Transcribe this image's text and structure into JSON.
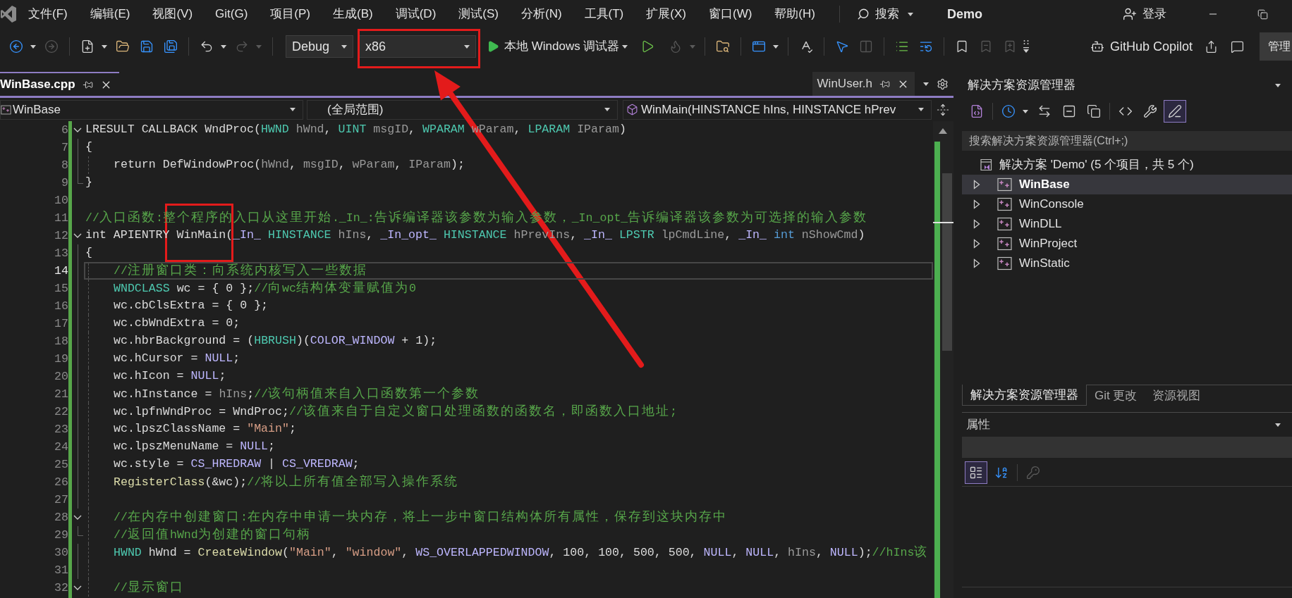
{
  "menu_bar": {
    "items": [
      "文件(F)",
      "编辑(E)",
      "视图(V)",
      "Git(G)",
      "项目(P)",
      "生成(B)",
      "调试(D)",
      "测试(S)",
      "分析(N)",
      "工具(T)",
      "扩展(X)",
      "窗口(W)",
      "帮助(H)"
    ],
    "search": "搜索",
    "solution": "Demo",
    "sign_in": "登录"
  },
  "toolbar": {
    "groups": [
      [
        {
          "kind": "back",
          "disabled": false
        },
        {
          "kind": "forward",
          "disabled": true
        }
      ],
      [
        {
          "kind": "new-item",
          "disabled": false
        },
        {
          "kind": "open",
          "disabled": false
        },
        {
          "kind": "save",
          "disabled": false
        },
        {
          "kind": "save-all",
          "disabled": false
        }
      ],
      [
        {
          "kind": "undo",
          "disabled": false
        },
        {
          "kind": "redo",
          "disabled": true
        }
      ],
      [
        {
          "kind": "configuration",
          "value": "Debug",
          "disabled": false
        },
        {
          "kind": "platform",
          "value": "x86",
          "disabled": false
        },
        {
          "kind": "start",
          "label": "本地 Windows 调试器",
          "disabled": false
        },
        {
          "kind": "start-without-debugging",
          "disabled": false
        },
        {
          "kind": "hot-reload",
          "disabled": true
        }
      ],
      [
        {
          "kind": "find-in-files",
          "disabled": false
        }
      ],
      [
        {
          "kind": "browser",
          "disabled": false
        }
      ],
      [
        {
          "kind": "spell-check",
          "disabled": false
        }
      ],
      [
        {
          "kind": "select-element",
          "disabled": false
        },
        {
          "kind": "columns",
          "disabled": true
        }
      ],
      [
        {
          "kind": "indent",
          "disabled": false
        },
        {
          "kind": "outdent",
          "disabled": false
        }
      ],
      [
        {
          "kind": "bookmark",
          "disabled": false
        },
        {
          "kind": "previous-bookmark",
          "disabled": true
        },
        {
          "kind": "next-bookmark",
          "disabled": true
        },
        {
          "kind": "overflow",
          "disabled": false
        }
      ]
    ],
    "copilot": "GitHub Copilot",
    "manage": "管理"
  },
  "document_tabs": [
    {
      "label": "WinBase.cpp",
      "selected": true,
      "preview": false
    },
    {
      "label": "WinUser.h",
      "selected": false,
      "preview": true
    }
  ],
  "navigation": {
    "project": "WinBase",
    "scope": "(全局范围)",
    "member": "WinMain(HINSTANCE hIns, HINSTANCE hPrev"
  },
  "editor": {
    "lines": [
      {
        "number": "6",
        "collapsible": true,
        "region_end": false,
        "indented": false,
        "current": false,
        "segments": [
          {
            "kind": "plain",
            "text": "LRESULT CALLBACK WndProc("
          },
          {
            "kind": "type",
            "text": "HWND "
          },
          {
            "kind": "param",
            "text": "hWnd"
          },
          {
            "kind": "plain",
            "text": ", "
          },
          {
            "kind": "type",
            "text": "UINT "
          },
          {
            "kind": "param",
            "text": "msgID"
          },
          {
            "kind": "plain",
            "text": ", "
          },
          {
            "kind": "type",
            "text": "WPARAM "
          },
          {
            "kind": "param",
            "text": "wParam"
          },
          {
            "kind": "plain",
            "text": ", "
          },
          {
            "kind": "type",
            "text": "LPARAM "
          },
          {
            "kind": "param",
            "text": "IParam"
          },
          {
            "kind": "plain",
            "text": ")"
          }
        ]
      },
      {
        "number": "7",
        "collapsible": false,
        "region_end": false,
        "indented": false,
        "current": false,
        "segments": [
          {
            "kind": "plain",
            "text": "{"
          }
        ]
      },
      {
        "number": "8",
        "collapsible": false,
        "region_end": false,
        "indented": true,
        "current": false,
        "segments": [
          {
            "kind": "plain",
            "text": "return DefWindowProc("
          },
          {
            "kind": "param",
            "text": "hWnd"
          },
          {
            "kind": "plain",
            "text": ", "
          },
          {
            "kind": "param",
            "text": "msgID"
          },
          {
            "kind": "plain",
            "text": ", "
          },
          {
            "kind": "param",
            "text": "wParam"
          },
          {
            "kind": "plain",
            "text": ", "
          },
          {
            "kind": "param",
            "text": "IParam"
          },
          {
            "kind": "plain",
            "text": ");"
          }
        ]
      },
      {
        "number": "9",
        "collapsible": false,
        "region_end": true,
        "indented": false,
        "current": false,
        "segments": [
          {
            "kind": "plain",
            "text": "}"
          }
        ]
      },
      {
        "number": "10",
        "collapsible": false,
        "region_end": false,
        "indented": false,
        "current": false
      },
      {
        "number": "11",
        "collapsible": false,
        "region_end": false,
        "indented": false,
        "current": false,
        "segments": [
          {
            "kind": "comment",
            "text": "//入口函数:整个程序的入口从这里开始._In_:告诉编译器该参数为输入参数，_In_opt_告诉编译器该参数为可选择的输入参数"
          }
        ]
      },
      {
        "number": "12",
        "collapsible": true,
        "region_end": false,
        "indented": false,
        "current": false,
        "segments": [
          {
            "kind": "plain",
            "text": "int APIENTRY WinMain("
          },
          {
            "kind": "macro",
            "text": "_In_ "
          },
          {
            "kind": "type",
            "text": "HINSTANCE "
          },
          {
            "kind": "param",
            "text": "hIns"
          },
          {
            "kind": "plain",
            "text": ", "
          },
          {
            "kind": "macro",
            "text": "_In_opt_ "
          },
          {
            "kind": "type",
            "text": "HINSTANCE "
          },
          {
            "kind": "param",
            "text": "hPrevIns"
          },
          {
            "kind": "plain",
            "text": ", "
          },
          {
            "kind": "macro",
            "text": "_In_ "
          },
          {
            "kind": "type",
            "text": "LPSTR "
          },
          {
            "kind": "param",
            "text": "lpCmdLine"
          },
          {
            "kind": "plain",
            "text": ", "
          },
          {
            "kind": "macro",
            "text": "_In_ "
          },
          {
            "kind": "keyword",
            "text": "int "
          },
          {
            "kind": "param",
            "text": "nShowCmd"
          },
          {
            "kind": "plain",
            "text": ")"
          }
        ]
      },
      {
        "number": "13",
        "collapsible": false,
        "region_end": false,
        "indented": false,
        "current": false,
        "segments": [
          {
            "kind": "plain",
            "text": "{"
          }
        ]
      },
      {
        "number": "14",
        "collapsible": false,
        "region_end": false,
        "indented": true,
        "current": true,
        "segments": [
          {
            "kind": "comment",
            "text": "//注册窗口类：向系统内核写入一些数据"
          }
        ]
      },
      {
        "number": "15",
        "collapsible": false,
        "region_end": false,
        "indented": true,
        "current": false,
        "segments": [
          {
            "kind": "type",
            "text": "WNDCLASS "
          },
          {
            "kind": "plain",
            "text": "wc = { 0 };"
          },
          {
            "kind": "comment",
            "text": "//向wc结构体变量赋值为0"
          }
        ]
      },
      {
        "number": "16",
        "collapsible": false,
        "region_end": false,
        "indented": true,
        "current": false,
        "segments": [
          {
            "kind": "plain",
            "text": "wc.cbClsExtra = { 0 };"
          }
        ]
      },
      {
        "number": "17",
        "collapsible": false,
        "region_end": false,
        "indented": true,
        "current": false,
        "segments": [
          {
            "kind": "plain",
            "text": "wc.cbWndExtra = 0;"
          }
        ]
      },
      {
        "number": "18",
        "collapsible": false,
        "region_end": false,
        "indented": true,
        "current": false,
        "segments": [
          {
            "kind": "plain",
            "text": "wc.hbrBackground = ("
          },
          {
            "kind": "type",
            "text": "HBRUSH"
          },
          {
            "kind": "plain",
            "text": ")("
          },
          {
            "kind": "macro",
            "text": "COLOR_WINDOW"
          },
          {
            "kind": "plain",
            "text": " + 1);"
          }
        ]
      },
      {
        "number": "19",
        "collapsible": false,
        "region_end": false,
        "indented": true,
        "current": false,
        "segments": [
          {
            "kind": "plain",
            "text": "wc.hCursor = "
          },
          {
            "kind": "macro",
            "text": "NULL"
          },
          {
            "kind": "plain",
            "text": ";"
          }
        ]
      },
      {
        "number": "20",
        "collapsible": false,
        "region_end": false,
        "indented": true,
        "current": false,
        "segments": [
          {
            "kind": "plain",
            "text": "wc.hIcon = "
          },
          {
            "kind": "macro",
            "text": "NULL"
          },
          {
            "kind": "plain",
            "text": ";"
          }
        ]
      },
      {
        "number": "21",
        "collapsible": false,
        "region_end": false,
        "indented": true,
        "current": false,
        "segments": [
          {
            "kind": "plain",
            "text": "wc.hInstance = "
          },
          {
            "kind": "param",
            "text": "hIns"
          },
          {
            "kind": "plain",
            "text": ";"
          },
          {
            "kind": "comment",
            "text": "//该句柄值来自入口函数第一个参数"
          }
        ]
      },
      {
        "number": "22",
        "collapsible": false,
        "region_end": false,
        "indented": true,
        "current": false,
        "segments": [
          {
            "kind": "plain",
            "text": "wc.lpfnWndProc = WndProc;"
          },
          {
            "kind": "comment",
            "text": "//该值来自于自定义窗口处理函数的函数名，即函数入口地址;"
          }
        ]
      },
      {
        "number": "23",
        "collapsible": false,
        "region_end": false,
        "indented": true,
        "current": false,
        "segments": [
          {
            "kind": "plain",
            "text": "wc.lpszClassName = "
          },
          {
            "kind": "string",
            "text": "\"Main\""
          },
          {
            "kind": "plain",
            "text": ";"
          }
        ]
      },
      {
        "number": "24",
        "collapsible": false,
        "region_end": false,
        "indented": true,
        "current": false,
        "segments": [
          {
            "kind": "plain",
            "text": "wc.lpszMenuName = "
          },
          {
            "kind": "macro",
            "text": "NULL"
          },
          {
            "kind": "plain",
            "text": ";"
          }
        ]
      },
      {
        "number": "25",
        "collapsible": false,
        "region_end": false,
        "indented": true,
        "current": false,
        "segments": [
          {
            "kind": "plain",
            "text": "wc.style = "
          },
          {
            "kind": "macro",
            "text": "CS_HREDRAW"
          },
          {
            "kind": "plain",
            "text": " | "
          },
          {
            "kind": "macro",
            "text": "CS_VREDRAW"
          },
          {
            "kind": "plain",
            "text": ";"
          }
        ]
      },
      {
        "number": "26",
        "collapsible": false,
        "region_end": false,
        "indented": true,
        "current": false,
        "segments": [
          {
            "kind": "function",
            "text": "RegisterClass"
          },
          {
            "kind": "plain",
            "text": "(&wc);"
          },
          {
            "kind": "comment",
            "text": "//将以上所有值全部写入操作系统"
          }
        ]
      },
      {
        "number": "27",
        "collapsible": false,
        "region_end": false,
        "indented": true,
        "current": false
      },
      {
        "number": "28",
        "collapsible": true,
        "region_end": false,
        "indented": true,
        "current": false,
        "segments": [
          {
            "kind": "comment",
            "text": "//在内存中创建窗口:在内存中申请一块内存，将上一步中窗口结构体所有属性，保存到这块内存中"
          }
        ]
      },
      {
        "number": "29",
        "collapsible": false,
        "region_end": true,
        "indented": true,
        "current": false,
        "segments": [
          {
            "kind": "comment",
            "text": "//返回值hWnd为创建的窗口句柄"
          }
        ]
      },
      {
        "number": "30",
        "collapsible": false,
        "region_end": false,
        "indented": true,
        "current": false,
        "segments": [
          {
            "kind": "type",
            "text": "HWND "
          },
          {
            "kind": "plain",
            "text": "hWnd = "
          },
          {
            "kind": "function",
            "text": "CreateWindow"
          },
          {
            "kind": "plain",
            "text": "("
          },
          {
            "kind": "string",
            "text": "\"Main\""
          },
          {
            "kind": "plain",
            "text": ", "
          },
          {
            "kind": "string",
            "text": "\"window\""
          },
          {
            "kind": "plain",
            "text": ", "
          },
          {
            "kind": "macro",
            "text": "WS_OVERLAPPEDWINDOW"
          },
          {
            "kind": "plain",
            "text": ", 100, 100, 500, 500, "
          },
          {
            "kind": "macro",
            "text": "NULL"
          },
          {
            "kind": "plain",
            "text": ", "
          },
          {
            "kind": "macro",
            "text": "NULL"
          },
          {
            "kind": "plain",
            "text": ", "
          },
          {
            "kind": "param",
            "text": "hIns"
          },
          {
            "kind": "plain",
            "text": ", "
          },
          {
            "kind": "macro",
            "text": "NULL"
          },
          {
            "kind": "plain",
            "text": ");"
          },
          {
            "kind": "comment",
            "text": "//hIns该"
          }
        ]
      },
      {
        "number": "31",
        "collapsible": false,
        "region_end": false,
        "indented": true,
        "current": false
      },
      {
        "number": "32",
        "collapsible": true,
        "region_end": false,
        "indented": true,
        "current": false,
        "segments": [
          {
            "kind": "comment",
            "text": "//显示窗口"
          }
        ]
      }
    ]
  },
  "solution_explorer": {
    "title": "解决方案资源管理器",
    "toolbar": [
      [
        {
          "kind": "switch-views",
          "selected": false
        }
      ],
      [
        {
          "kind": "pending-changes",
          "selected": false
        },
        {
          "kind": "sync",
          "selected": false
        },
        {
          "kind": "collapse-all",
          "selected": false
        },
        {
          "kind": "show-all-files",
          "selected": false
        }
      ],
      [
        {
          "kind": "view-code",
          "selected": false
        },
        {
          "kind": "properties",
          "selected": false
        },
        {
          "kind": "preview",
          "selected": true
        }
      ]
    ],
    "search": {
      "placeholder": "搜索解决方案资源管理器(Ctrl+;)"
    },
    "tree": [
      {
        "label": "解决方案 'Demo' (5 个项目，共 5 个)",
        "selected": false,
        "children": [
          {
            "label": "WinBase",
            "expanded": false,
            "selected": true,
            "startup": true
          },
          {
            "label": "WinConsole",
            "expanded": false,
            "selected": false,
            "startup": false
          },
          {
            "label": "WinDLL",
            "expanded": false,
            "selected": false,
            "startup": false
          },
          {
            "label": "WinProject",
            "expanded": false,
            "selected": false,
            "startup": false
          },
          {
            "label": "WinStatic",
            "expanded": false,
            "selected": false,
            "startup": false
          }
        ]
      }
    ]
  },
  "panel_tabs": [
    {
      "label": "解决方案资源管理器",
      "selected": true
    },
    {
      "label": "Git 更改",
      "selected": false
    },
    {
      "label": "资源视图",
      "selected": false
    }
  ],
  "properties": {
    "title": "属性",
    "toolbar": [
      {
        "kind": "categorized",
        "selected": true,
        "disabled": false
      },
      {
        "kind": "alphabetical",
        "selected": false,
        "disabled": false
      },
      {
        "kind": "property-pages",
        "selected": false,
        "disabled": true
      }
    ]
  }
}
